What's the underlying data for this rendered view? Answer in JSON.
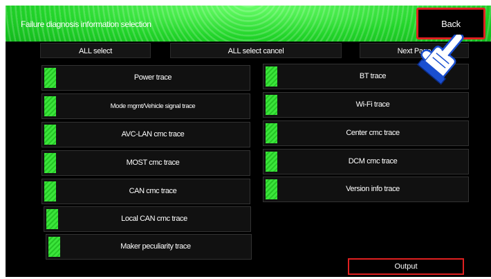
{
  "header": {
    "title": "Failure diagnosis information selection",
    "back_label": "Back"
  },
  "toolbar": {
    "all_select": "ALL select",
    "all_select_cancel": "ALL select cancel",
    "next_page": "Next Page"
  },
  "left_items": [
    "Power trace",
    "Mode mgmt/Vehicle signal trace",
    "AVC-LAN cmc trace",
    "MOST cmc trace",
    "CAN cmc trace",
    "Local CAN cmc trace",
    "Maker peculiarity trace"
  ],
  "right_items": [
    "BT trace",
    "Wi-Fi trace",
    "Center cmc trace",
    "DCM cmc trace",
    "Version info trace"
  ],
  "output_label": "Output",
  "colors": {
    "accent_green": "#22d52a",
    "highlight_red": "#e02020"
  },
  "icons": {
    "pointer": "pointing-hand-icon",
    "checkbox": "checked-box-icon"
  }
}
